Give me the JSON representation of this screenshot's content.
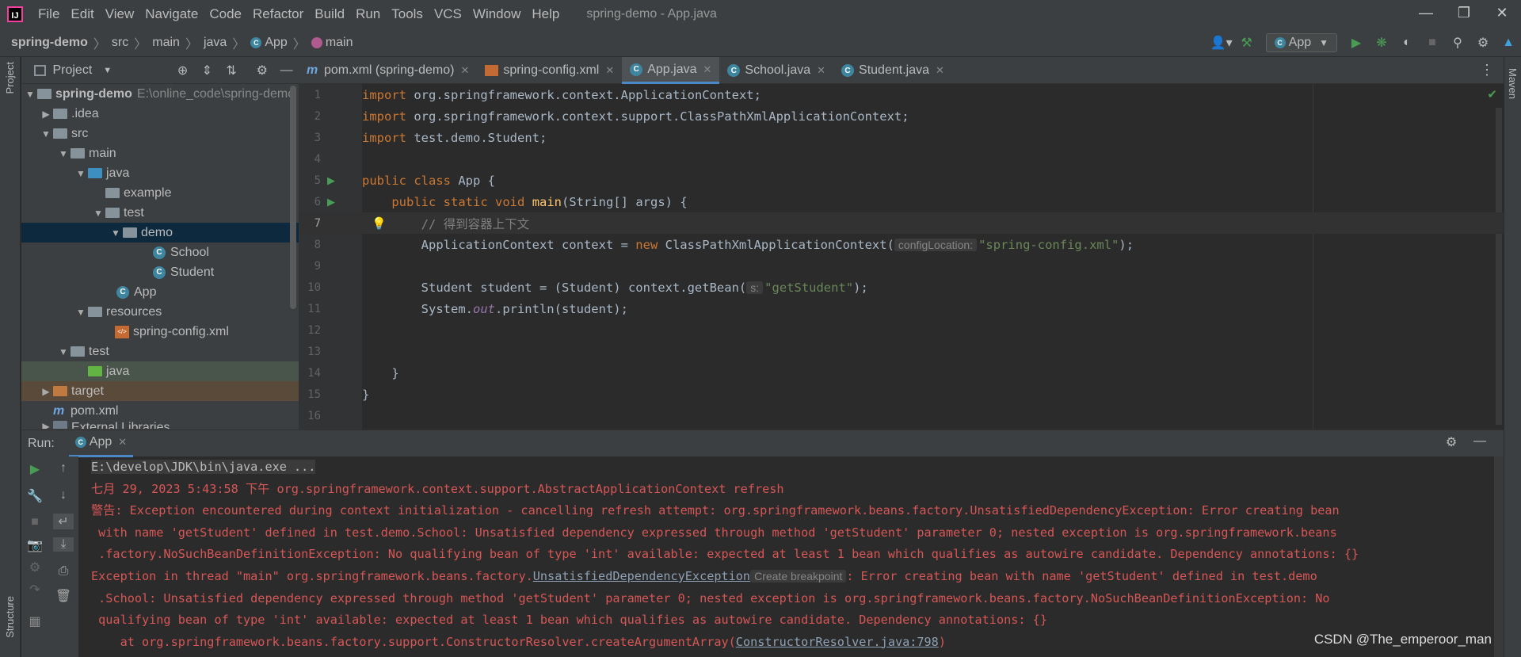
{
  "app": {
    "logo": "IJ",
    "window_title": "spring-demo - App.java"
  },
  "menu": [
    "File",
    "Edit",
    "View",
    "Navigate",
    "Code",
    "Refactor",
    "Build",
    "Run",
    "Tools",
    "VCS",
    "Window",
    "Help"
  ],
  "breadcrumb": [
    "spring-demo",
    "src",
    "main",
    "java",
    "App",
    "main"
  ],
  "run_config": "App",
  "left_strip_label": "Project",
  "bottom_strip_label": "Structure",
  "right_strip_label": "Maven",
  "project": {
    "header": "Project",
    "tree": [
      {
        "label": "spring-demo",
        "path": "E:\\online_code\\spring-demo",
        "icon": "folder"
      },
      {
        "label": ".idea",
        "icon": "folder"
      },
      {
        "label": "src",
        "icon": "folder"
      },
      {
        "label": "main",
        "icon": "folder"
      },
      {
        "label": "java",
        "icon": "folder-blue"
      },
      {
        "label": "example",
        "icon": "package"
      },
      {
        "label": "test",
        "icon": "package"
      },
      {
        "label": "demo",
        "icon": "package"
      },
      {
        "label": "School",
        "icon": "java-class"
      },
      {
        "label": "Student",
        "icon": "java-class"
      },
      {
        "label": "App",
        "icon": "java-class"
      },
      {
        "label": "resources",
        "icon": "folder"
      },
      {
        "label": "spring-config.xml",
        "icon": "xml"
      },
      {
        "label": "test",
        "icon": "folder"
      },
      {
        "label": "java",
        "icon": "folder-green"
      },
      {
        "label": "target",
        "icon": "folder-orange"
      },
      {
        "label": "pom.xml",
        "icon": "maven"
      },
      {
        "label": "External Libraries",
        "icon": "library"
      }
    ]
  },
  "tabs": [
    {
      "label": "pom.xml (spring-demo)",
      "icon": "maven"
    },
    {
      "label": "spring-config.xml",
      "icon": "xml"
    },
    {
      "label": "App.java",
      "icon": "java-class",
      "active": true
    },
    {
      "label": "School.java",
      "icon": "java-class"
    },
    {
      "label": "Student.java",
      "icon": "java-class"
    }
  ],
  "editor": {
    "line_numbers": [
      "1",
      "2",
      "3",
      "4",
      "5",
      "6",
      "7",
      "8",
      "9",
      "10",
      "11",
      "12",
      "13",
      "14",
      "15",
      "16"
    ],
    "tokens": {
      "import": "import",
      "l1": "org.springframework.context.ApplicationContext;",
      "l2": "org.springframework.context.support.ClassPathXmlApplicationContext;",
      "l3": "test.demo.Student;",
      "public": "public",
      "class": "class",
      "l5rest": " App {",
      "static": "static",
      "void": "void",
      "main": "main",
      "l6rest": "(String[] args) {",
      "comment": "// 得到容器上下文",
      "l8a": "ApplicationContext context = ",
      "new": "new",
      "l8b": " ClassPathXmlApplicationContext(",
      "hint1": "configLocation:",
      "str1": "\"spring-config.xml\"",
      "l8c": ");",
      "l10a": "Student student = (Student) context.getBean(",
      "hint2": "s:",
      "str2": "\"getStudent\"",
      "l10c": ");",
      "l11a": "System.",
      "out": "out",
      "l11b": ".println(student);",
      "rbrace": "}"
    }
  },
  "run": {
    "label": "Run:",
    "tab": "App",
    "console": {
      "cmd": "E:\\develop\\JDK\\bin\\java.exe ...",
      "line2": "七月 29, 2023 5:43:58 下午 org.springframework.context.support.AbstractApplicationContext refresh",
      "line3": "警告: Exception encountered during context initialization - cancelling refresh attempt: org.springframework.beans.factory.UnsatisfiedDependencyException: Error creating bean",
      "line4": " with name 'getStudent' defined in test.demo.School: Unsatisfied dependency expressed through method 'getStudent' parameter 0; nested exception is org.springframework.beans",
      "line5": " .factory.NoSuchBeanDefinitionException: No qualifying bean of type 'int' available: expected at least 1 bean which qualifies as autowire candidate. Dependency annotations: {}",
      "line6a": "Exception in thread \"main\" org.springframework.beans.factory.",
      "line6link": "UnsatisfiedDependencyException",
      "line6bp": "Create breakpoint",
      "line6b": ": Error creating bean with name 'getStudent' defined in test.demo",
      "line7": " .School: Unsatisfied dependency expressed through method 'getStudent' parameter 0; nested exception is org.springframework.beans.factory.NoSuchBeanDefinitionException: No",
      "line8": " qualifying bean of type 'int' available: expected at least 1 bean which qualifies as autowire candidate. Dependency annotations: {}",
      "line9a": "    at org.springframework.beans.factory.support.ConstructorResolver.createArgumentArray(",
      "line9link": "ConstructorResolver.java:798",
      "line9b": ")"
    }
  },
  "watermark": "CSDN @The_emperoor_man"
}
